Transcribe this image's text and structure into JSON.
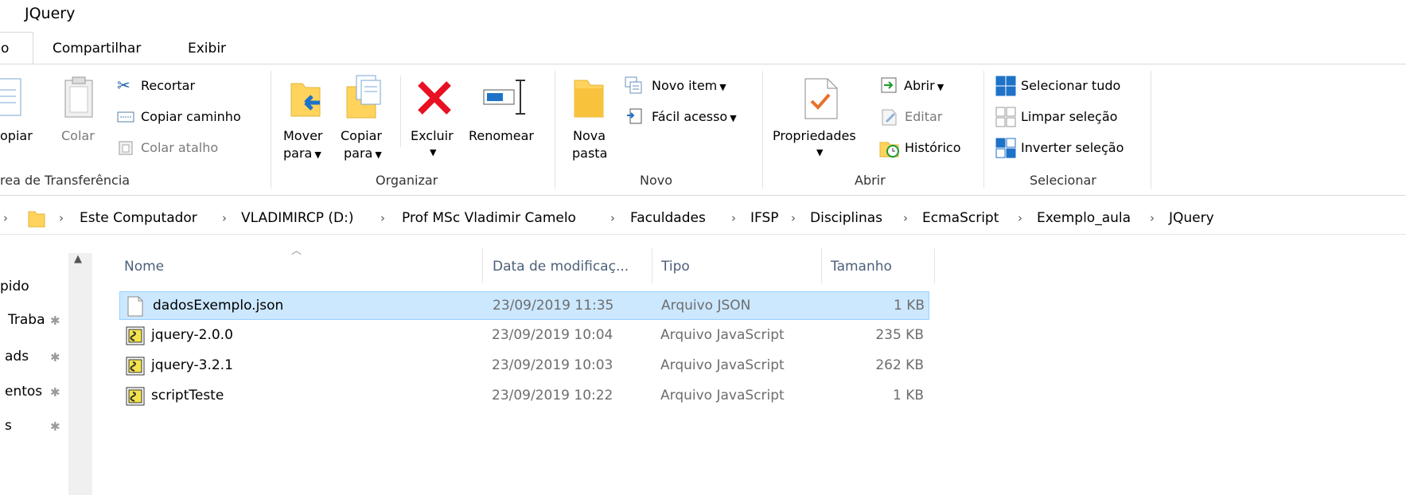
{
  "window": {
    "title": "JQuery"
  },
  "tabs": {
    "active_stub": "o",
    "share": "Compartilhar",
    "view": "Exibir"
  },
  "clipboard": {
    "copy": "opiar",
    "paste": "Colar",
    "cut": "Recortar",
    "copy_path": "Copiar caminho",
    "paste_shortcut": "Colar atalho",
    "group": "rea de Transferência"
  },
  "organize": {
    "move_to_1": "Mover",
    "move_to_2": "para",
    "copy_to_1": "Copiar",
    "copy_to_2": "para",
    "delete": "Excluir",
    "rename": "Renomear",
    "group": "Organizar"
  },
  "new": {
    "folder_1": "Nova",
    "folder_2": "pasta",
    "new_item": "Novo item",
    "easy_access": "Fácil acesso",
    "group": "Novo"
  },
  "open": {
    "properties": "Propriedades",
    "open": "Abrir",
    "edit": "Editar",
    "history": "Histórico",
    "group": "Abrir"
  },
  "select": {
    "select_all": "Selecionar tudo",
    "select_none": "Limpar seleção",
    "invert": "Inverter seleção",
    "group": "Selecionar"
  },
  "address": {
    "crumbs": [
      "Este Computador",
      "VLADIMIRCP (D:)",
      "Prof MSc Vladimir Camelo",
      "Faculdades",
      "IFSP",
      "Disciplinas",
      "EcmaScript",
      "Exemplo_aula",
      "JQuery"
    ]
  },
  "nav": {
    "items": [
      "pido",
      "Traba",
      "ads",
      "entos",
      "s"
    ]
  },
  "columns": {
    "name": "Nome",
    "date": "Data de modificaç...",
    "type": "Tipo",
    "size": "Tamanho"
  },
  "files": [
    {
      "name": "dadosExemplo.json",
      "date": "23/09/2019 11:35",
      "type": "Arquivo JSON",
      "size": "1 KB",
      "icon": "json-file-icon",
      "selected": true
    },
    {
      "name": "jquery-2.0.0",
      "date": "23/09/2019 10:04",
      "type": "Arquivo JavaScript",
      "size": "235 KB",
      "icon": "javascript-file-icon",
      "selected": false
    },
    {
      "name": "jquery-3.2.1",
      "date": "23/09/2019 10:03",
      "type": "Arquivo JavaScript",
      "size": "262 KB",
      "icon": "javascript-file-icon",
      "selected": false
    },
    {
      "name": "scriptTeste",
      "date": "23/09/2019 10:22",
      "type": "Arquivo JavaScript",
      "size": "1 KB",
      "icon": "javascript-file-icon",
      "selected": false
    }
  ],
  "colors": {
    "accent": "#0078d7",
    "selection": "#cce8ff",
    "delete_red": "#e81123",
    "folder_yellow": "#ffd35c"
  }
}
